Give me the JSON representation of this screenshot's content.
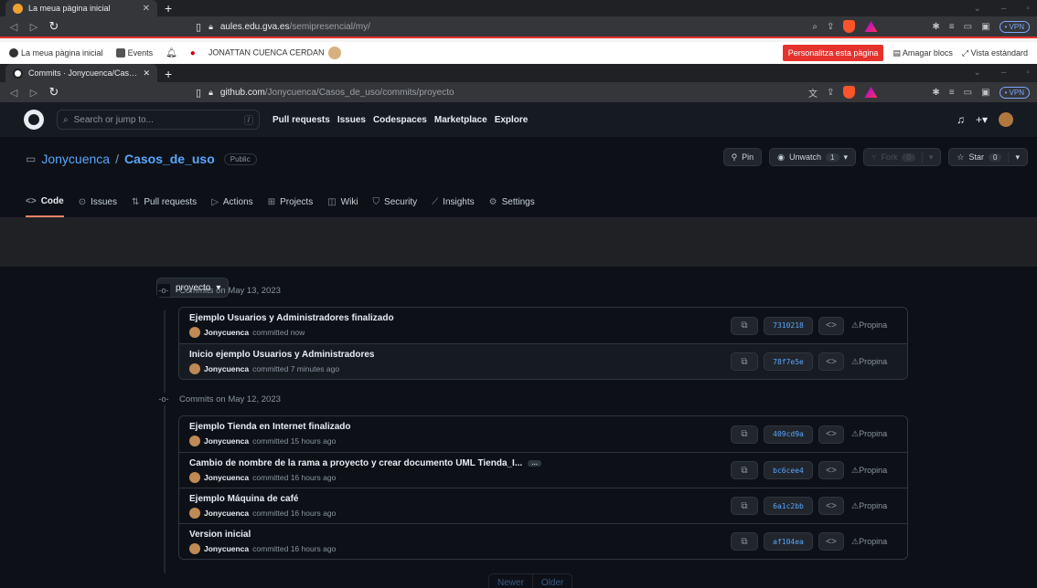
{
  "browser1": {
    "tab_title": "La meua pàgina inicial",
    "url_domain": "aules.edu.gva.es",
    "url_path": "/semipresencial/my/"
  },
  "moodle": {
    "home": "La meua pàgina inicial",
    "events": "Events",
    "user": "JONATTAN CUENCA CERDAN",
    "customize": "Personalitza esta pàgina",
    "hide_blocks": "Amagar blocs",
    "standard_view": "Vista estàndard"
  },
  "browser2": {
    "tab_title": "Commits · Jonycuenca/Casos de uso",
    "url_domain": "github.com",
    "url_path": "/Jonycuenca/Casos_de_uso/commits/proyecto",
    "vpn": "• VPN"
  },
  "github": {
    "search_placeholder": "Search or jump to...",
    "slash": "/",
    "nav": [
      "Pull requests",
      "Issues",
      "Codespaces",
      "Marketplace",
      "Explore"
    ]
  },
  "repo": {
    "owner": "Jonycuenca",
    "separator": "/",
    "name": "Casos_de_uso",
    "visibility": "Public",
    "pin": "Pin",
    "unwatch": "Unwatch",
    "watch_count": "1",
    "fork": "Fork",
    "fork_count": "0",
    "star": "Star",
    "star_count": "0",
    "tabs": [
      "Code",
      "Issues",
      "Pull requests",
      "Actions",
      "Projects",
      "Wiki",
      "Security",
      "Insights",
      "Settings"
    ]
  },
  "branch": "proyecto",
  "days": [
    {
      "heading": "Commits on May 13, 2023",
      "commits": [
        {
          "title": "Ejemplo Usuarios y Administradores finalizado",
          "author": "Jonycuenca",
          "when": "committed now",
          "sha": "7310218",
          "extra": "Propina"
        },
        {
          "title": "Inicio ejemplo Usuarios y Administradores",
          "author": "Jonycuenca",
          "when": "committed 7 minutes ago",
          "sha": "78f7e5e",
          "extra": "Propina"
        }
      ]
    },
    {
      "heading": "Commits on May 12, 2023",
      "commits": [
        {
          "title": "Ejemplo Tienda en Internet finalizado",
          "author": "Jonycuenca",
          "when": "committed 15 hours ago",
          "sha": "409cd9a",
          "extra": "Propina"
        },
        {
          "title": "Cambio de nombre de la rama a proyecto y crear documento UML Tienda_I...",
          "author": "Jonycuenca",
          "when": "committed 16 hours ago",
          "sha": "bc6cee4",
          "extra": "Propina",
          "ellipsis": "…"
        },
        {
          "title": "Ejemplo Máquina de café",
          "author": "Jonycuenca",
          "when": "committed 16 hours ago",
          "sha": "6a1c2bb",
          "extra": "Propina"
        },
        {
          "title": "Version inicial",
          "author": "Jonycuenca",
          "when": "committed 16 hours ago",
          "sha": "af104ea",
          "extra": "Propina"
        }
      ]
    }
  ],
  "pager": {
    "newer": "Newer",
    "older": "Older"
  }
}
